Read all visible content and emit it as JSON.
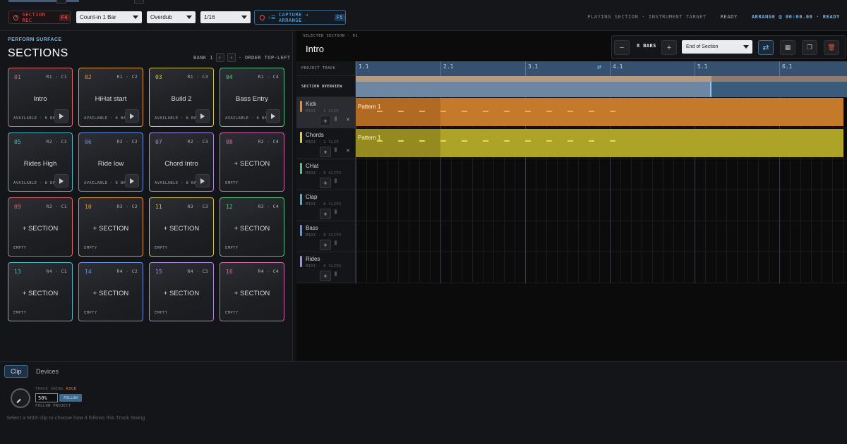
{
  "toolbar": {
    "section_rec": {
      "label": "SECTION REC",
      "key": "F4"
    },
    "countin": "Count-in 1 Bar",
    "mode": "Overdub",
    "quantize": "1/16",
    "capture": {
      "label": "CAPTURE → ARRANGE",
      "key": "F5"
    },
    "status": {
      "playing": "PLAYING SECTION · INSTRUMENT TARGET",
      "ready": "READY",
      "arrange": "ARRANGE @ 00:00.00 · READY"
    }
  },
  "perform": {
    "label": "PERFORM SURFACE",
    "title": "SECTIONS",
    "bank_label": "BANK 1",
    "order_label": "· ORDER TOP-LEFT",
    "pads": [
      {
        "num": "01",
        "rc": "R1 · C1",
        "name": "Intro",
        "status": "AVAILABLE · 8 BA",
        "color": "#e0666a",
        "play": true
      },
      {
        "num": "02",
        "rc": "R1 · C2",
        "name": "HiHat start",
        "status": "AVAILABLE · 8 BA",
        "color": "#e59a3a",
        "play": true
      },
      {
        "num": "03",
        "rc": "R1 · C3",
        "name": "Build 2",
        "status": "AVAILABLE · 8 BA",
        "color": "#cfc24a",
        "play": true
      },
      {
        "num": "04",
        "rc": "R1 · C4",
        "name": "Bass Entry",
        "status": "AVAILABLE · 8 BA",
        "color": "#5cc486",
        "play": true
      },
      {
        "num": "05",
        "rc": "R2 · C1",
        "name": "Rides High",
        "status": "AVAILABLE · 8 BA",
        "color": "#4fb7c4",
        "play": true
      },
      {
        "num": "06",
        "rc": "R2 · C2",
        "name": "Ride low",
        "status": "AVAILABLE · 8 BA",
        "color": "#6a8fe0",
        "play": true
      },
      {
        "num": "07",
        "rc": "R2 · C3",
        "name": "Chord Intro",
        "status": "AVAILABLE · 8 BA",
        "color": "#a98ae0",
        "play": true
      },
      {
        "num": "08",
        "rc": "R2 · C4",
        "name": "+ SECTION",
        "status": "EMPTY",
        "color": "#d06aa8",
        "play": false
      },
      {
        "num": "09",
        "rc": "R3 · C1",
        "name": "+ SECTION",
        "status": "EMPTY",
        "color": "#e0666a",
        "play": false
      },
      {
        "num": "10",
        "rc": "R3 · C2",
        "name": "+ SECTION",
        "status": "EMPTY",
        "color": "#e59a3a",
        "play": false
      },
      {
        "num": "11",
        "rc": "R3 · C3",
        "name": "+ SECTION",
        "status": "EMPTY",
        "color": "#cfc24a",
        "play": false
      },
      {
        "num": "12",
        "rc": "R3 · C4",
        "name": "+ SECTION",
        "status": "EMPTY",
        "color": "#5cc486",
        "play": false
      },
      {
        "num": "13",
        "rc": "R4 · C1",
        "name": "+ SECTION",
        "status": "EMPTY",
        "color": "#4fb7c4",
        "play": false
      },
      {
        "num": "14",
        "rc": "R4 · C2",
        "name": "+ SECTION",
        "status": "EMPTY",
        "color": "#6a8fe0",
        "play": false
      },
      {
        "num": "15",
        "rc": "R4 · C3",
        "name": "+ SECTION",
        "status": "EMPTY",
        "color": "#a98ae0",
        "play": false
      },
      {
        "num": "16",
        "rc": "R4 · C4",
        "name": "+ SECTION",
        "status": "EMPTY",
        "color": "#d06aa8",
        "play": false
      }
    ]
  },
  "arrange": {
    "selected_label": "SELECTED SECTION · 01",
    "selected_title": "Intro",
    "bars": "8 BARS",
    "end_mode": "End of Section",
    "project_track": "PROJECT TRACK",
    "section_overview": "SECTION OVERVIEW",
    "ruler": [
      "1.1",
      "2.1",
      "3.1",
      "4.1",
      "5.1",
      "6.1"
    ],
    "tracks": [
      {
        "name": "Kick",
        "meta": "MIDI · 1 CLIP",
        "color": "#f08a2c",
        "clip": "Pattern 1",
        "x_icon": true,
        "clip_fill": "#b06a24",
        "clip_fill2": "#c57a2b",
        "note": "#f5a94d"
      },
      {
        "name": "Chords",
        "meta": "MIDI · 1 CLIP",
        "color": "#e0d03a",
        "clip": "Pattern 1",
        "x_icon": true,
        "clip_fill": "#948a20",
        "clip_fill2": "#ada326",
        "note": "#e6dc5a"
      },
      {
        "name": "CHat",
        "meta": "MIDI · 0 CLIPS",
        "color": "#5cc486",
        "clip": null,
        "x_icon": false
      },
      {
        "name": "Clap",
        "meta": "MIDI · 0 CLIPS",
        "color": "#4fb7c4",
        "clip": null,
        "x_icon": false
      },
      {
        "name": "Bass",
        "meta": "MIDI · 0 CLIPS",
        "color": "#6a8fe0",
        "clip": null,
        "x_icon": false
      },
      {
        "name": "Rides",
        "meta": "MIDI · 0 CLIPS",
        "color": "#a98ae0",
        "clip": null,
        "x_icon": false
      }
    ]
  },
  "bottom": {
    "tabs": [
      "Clip",
      "Devices"
    ],
    "swing_label": "TRACK SWING",
    "swing_track": "KICK",
    "swing_value": "50%",
    "follow_label": "FOLLOW",
    "follow_project": "FOLLOW PROJECT",
    "hint": "Select a MIDI clip to choose how it follows this Track Swing"
  },
  "icons": {
    "loop": "loop-icon",
    "grid": "grid-icon",
    "copy": "copy-icon",
    "delete": "trash-icon",
    "play": "play-icon",
    "add": "plus-icon",
    "mixer": "mixer-icon",
    "close": "close-icon"
  }
}
